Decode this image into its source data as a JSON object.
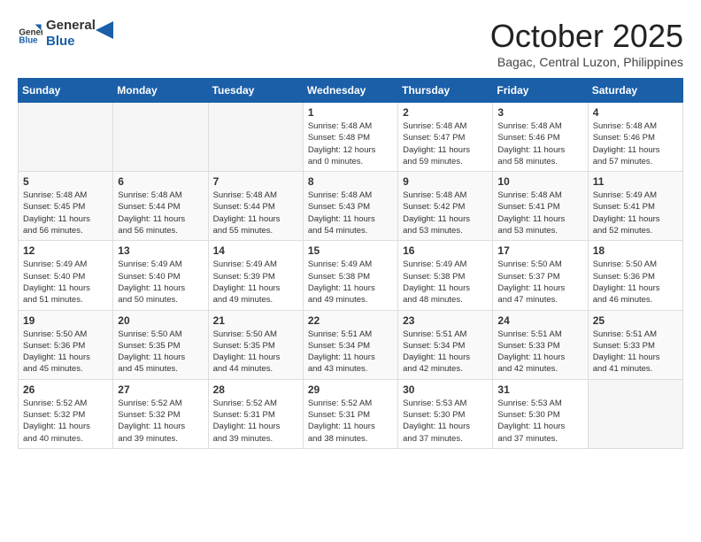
{
  "header": {
    "logo_line1": "General",
    "logo_line2": "Blue",
    "month": "October 2025",
    "location": "Bagac, Central Luzon, Philippines"
  },
  "weekdays": [
    "Sunday",
    "Monday",
    "Tuesday",
    "Wednesday",
    "Thursday",
    "Friday",
    "Saturday"
  ],
  "weeks": [
    [
      {
        "day": "",
        "info": ""
      },
      {
        "day": "",
        "info": ""
      },
      {
        "day": "",
        "info": ""
      },
      {
        "day": "1",
        "info": "Sunrise: 5:48 AM\nSunset: 5:48 PM\nDaylight: 12 hours\nand 0 minutes."
      },
      {
        "day": "2",
        "info": "Sunrise: 5:48 AM\nSunset: 5:47 PM\nDaylight: 11 hours\nand 59 minutes."
      },
      {
        "day": "3",
        "info": "Sunrise: 5:48 AM\nSunset: 5:46 PM\nDaylight: 11 hours\nand 58 minutes."
      },
      {
        "day": "4",
        "info": "Sunrise: 5:48 AM\nSunset: 5:46 PM\nDaylight: 11 hours\nand 57 minutes."
      }
    ],
    [
      {
        "day": "5",
        "info": "Sunrise: 5:48 AM\nSunset: 5:45 PM\nDaylight: 11 hours\nand 56 minutes."
      },
      {
        "day": "6",
        "info": "Sunrise: 5:48 AM\nSunset: 5:44 PM\nDaylight: 11 hours\nand 56 minutes."
      },
      {
        "day": "7",
        "info": "Sunrise: 5:48 AM\nSunset: 5:44 PM\nDaylight: 11 hours\nand 55 minutes."
      },
      {
        "day": "8",
        "info": "Sunrise: 5:48 AM\nSunset: 5:43 PM\nDaylight: 11 hours\nand 54 minutes."
      },
      {
        "day": "9",
        "info": "Sunrise: 5:48 AM\nSunset: 5:42 PM\nDaylight: 11 hours\nand 53 minutes."
      },
      {
        "day": "10",
        "info": "Sunrise: 5:48 AM\nSunset: 5:41 PM\nDaylight: 11 hours\nand 53 minutes."
      },
      {
        "day": "11",
        "info": "Sunrise: 5:49 AM\nSunset: 5:41 PM\nDaylight: 11 hours\nand 52 minutes."
      }
    ],
    [
      {
        "day": "12",
        "info": "Sunrise: 5:49 AM\nSunset: 5:40 PM\nDaylight: 11 hours\nand 51 minutes."
      },
      {
        "day": "13",
        "info": "Sunrise: 5:49 AM\nSunset: 5:40 PM\nDaylight: 11 hours\nand 50 minutes."
      },
      {
        "day": "14",
        "info": "Sunrise: 5:49 AM\nSunset: 5:39 PM\nDaylight: 11 hours\nand 49 minutes."
      },
      {
        "day": "15",
        "info": "Sunrise: 5:49 AM\nSunset: 5:38 PM\nDaylight: 11 hours\nand 49 minutes."
      },
      {
        "day": "16",
        "info": "Sunrise: 5:49 AM\nSunset: 5:38 PM\nDaylight: 11 hours\nand 48 minutes."
      },
      {
        "day": "17",
        "info": "Sunrise: 5:50 AM\nSunset: 5:37 PM\nDaylight: 11 hours\nand 47 minutes."
      },
      {
        "day": "18",
        "info": "Sunrise: 5:50 AM\nSunset: 5:36 PM\nDaylight: 11 hours\nand 46 minutes."
      }
    ],
    [
      {
        "day": "19",
        "info": "Sunrise: 5:50 AM\nSunset: 5:36 PM\nDaylight: 11 hours\nand 45 minutes."
      },
      {
        "day": "20",
        "info": "Sunrise: 5:50 AM\nSunset: 5:35 PM\nDaylight: 11 hours\nand 45 minutes."
      },
      {
        "day": "21",
        "info": "Sunrise: 5:50 AM\nSunset: 5:35 PM\nDaylight: 11 hours\nand 44 minutes."
      },
      {
        "day": "22",
        "info": "Sunrise: 5:51 AM\nSunset: 5:34 PM\nDaylight: 11 hours\nand 43 minutes."
      },
      {
        "day": "23",
        "info": "Sunrise: 5:51 AM\nSunset: 5:34 PM\nDaylight: 11 hours\nand 42 minutes."
      },
      {
        "day": "24",
        "info": "Sunrise: 5:51 AM\nSunset: 5:33 PM\nDaylight: 11 hours\nand 42 minutes."
      },
      {
        "day": "25",
        "info": "Sunrise: 5:51 AM\nSunset: 5:33 PM\nDaylight: 11 hours\nand 41 minutes."
      }
    ],
    [
      {
        "day": "26",
        "info": "Sunrise: 5:52 AM\nSunset: 5:32 PM\nDaylight: 11 hours\nand 40 minutes."
      },
      {
        "day": "27",
        "info": "Sunrise: 5:52 AM\nSunset: 5:32 PM\nDaylight: 11 hours\nand 39 minutes."
      },
      {
        "day": "28",
        "info": "Sunrise: 5:52 AM\nSunset: 5:31 PM\nDaylight: 11 hours\nand 39 minutes."
      },
      {
        "day": "29",
        "info": "Sunrise: 5:52 AM\nSunset: 5:31 PM\nDaylight: 11 hours\nand 38 minutes."
      },
      {
        "day": "30",
        "info": "Sunrise: 5:53 AM\nSunset: 5:30 PM\nDaylight: 11 hours\nand 37 minutes."
      },
      {
        "day": "31",
        "info": "Sunrise: 5:53 AM\nSunset: 5:30 PM\nDaylight: 11 hours\nand 37 minutes."
      },
      {
        "day": "",
        "info": ""
      }
    ]
  ]
}
